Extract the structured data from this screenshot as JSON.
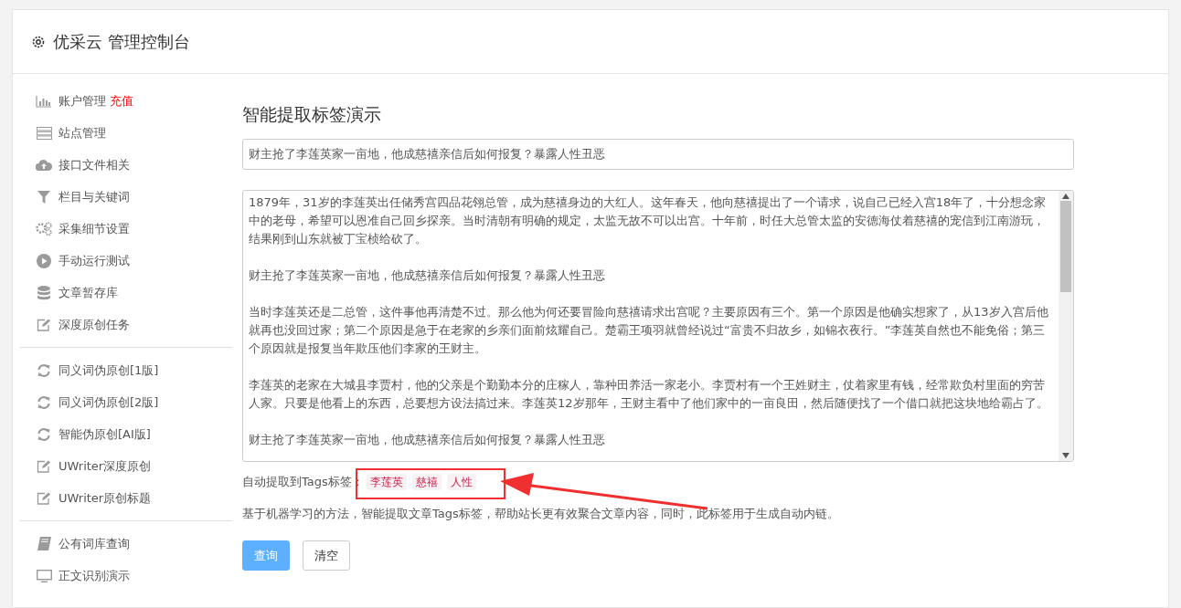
{
  "header": {
    "title": "优采云 管理控制台"
  },
  "sidebar": {
    "groups": [
      {
        "items": [
          {
            "label": "账户管理",
            "badge": "充值"
          },
          {
            "label": "站点管理"
          },
          {
            "label": "接口文件相关"
          },
          {
            "label": "栏目与关键词"
          },
          {
            "label": "采集细节设置"
          },
          {
            "label": "手动运行测试"
          },
          {
            "label": "文章暂存库"
          },
          {
            "label": "深度原创任务"
          }
        ]
      },
      {
        "items": [
          {
            "label": "同义词伪原创[1版]"
          },
          {
            "label": "同义词伪原创[2版]"
          },
          {
            "label": "智能伪原创[AI版]"
          },
          {
            "label": "UWriter深度原创"
          },
          {
            "label": "UWriter原创标题"
          }
        ]
      },
      {
        "items": [
          {
            "label": "公有词库查询"
          },
          {
            "label": "正文识别演示"
          }
        ]
      }
    ]
  },
  "main": {
    "heading": "智能提取标签演示",
    "title_field": {
      "value": "财主抢了李莲英家一亩地，他成慈禧亲信后如何报复？暴露人性丑恶"
    },
    "body_field": {
      "paragraphs": [
        "1879年，31岁的李莲英出任储秀宫四品花翎总管，成为慈禧身边的大红人。这年春天，他向慈禧提出了一个请求，说自己已经入宫18年了，十分想念家中的老母，希望可以恩准自己回乡探亲。当时清朝有明确的规定，太监无故不可以出宫。十年前，时任大总管太监的安德海仗着慈禧的宠信到江南游玩，结果刚到山东就被丁宝桢给砍了。",
        "财主抢了李莲英家一亩地，他成慈禧亲信后如何报复？暴露人性丑恶",
        "当时李莲英还是二总管，这件事他再清楚不过。那么他为何还要冒险向慈禧请求出宫呢？主要原因有三个。第一个原因是他确实想家了，从13岁入宫后他就再也没回过家；第二个原因是急于在老家的乡亲们面前炫耀自己。楚霸王项羽就曾经说过“富贵不归故乡，如锦衣夜行。”李莲英自然也不能免俗；第三个原因就是报复当年欺压他们李家的王财主。",
        "李莲英的老家在大城县李贾村，他的父亲是个勤勤本分的庄稼人，靠种田养活一家老小。李贾村有一个王姓财主，仗着家里有钱，经常欺负村里面的穷苦人家。只要是他看上的东西，总要想方设法搞过来。李莲英12岁那年，王财主看中了他们家中的一亩良田，然后随便找了一个借口就把这块地给霸占了。",
        "财主抢了李莲英家一亩地，他成慈禧亲信后如何报复？暴露人性丑恶"
      ]
    },
    "tags_label": "自动提取到Tags标签：",
    "tags": [
      "李莲英",
      "慈禧",
      "人性"
    ],
    "description": "基于机器学习的方法，智能提取文章Tags标签，帮助站长更有效聚合文章内容，同时，此标签用于生成自动内链。",
    "buttons": [
      {
        "label": "查询",
        "kind": "primary"
      },
      {
        "label": "清空",
        "kind": "default"
      }
    ]
  }
}
